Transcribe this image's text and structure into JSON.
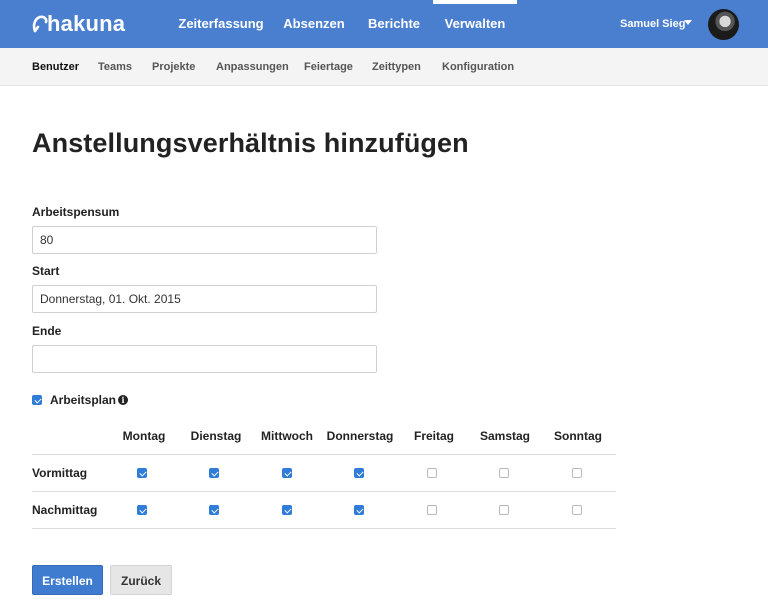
{
  "brand": {
    "name": "hakuna"
  },
  "topnav": {
    "items": [
      {
        "label": "Zeiterfassung",
        "active": false
      },
      {
        "label": "Absenzen",
        "active": false
      },
      {
        "label": "Berichte",
        "active": false
      },
      {
        "label": "Verwalten",
        "active": true
      }
    ],
    "user": {
      "name": "Samuel Sieg",
      "avatar_icon": "user-avatar"
    }
  },
  "subnav": {
    "items": [
      {
        "label": "Benutzer",
        "active": true
      },
      {
        "label": "Teams",
        "active": false
      },
      {
        "label": "Projekte",
        "active": false
      },
      {
        "label": "Anpassungen",
        "active": false
      },
      {
        "label": "Feiertage",
        "active": false
      },
      {
        "label": "Zeittypen",
        "active": false
      },
      {
        "label": "Konfiguration",
        "active": false
      }
    ]
  },
  "form": {
    "title": "Anstellungsverhältnis hinzufügen",
    "fields": {
      "pensum": {
        "label": "Arbeitspensum",
        "value": "80"
      },
      "start": {
        "label": "Start",
        "value": "Donnerstag, 01. Okt. 2015"
      },
      "ende": {
        "label": "Ende",
        "value": ""
      }
    },
    "arbeitsplan": {
      "label": "Arbeitsplan",
      "checked": true,
      "info_icon": "info-circle-icon"
    },
    "schedule": {
      "days": [
        "Montag",
        "Dienstag",
        "Mittwoch",
        "Donnerstag",
        "Freitag",
        "Samstag",
        "Sonntag"
      ],
      "rows": [
        {
          "label": "Vormittag",
          "values": [
            true,
            true,
            true,
            true,
            false,
            false,
            false
          ]
        },
        {
          "label": "Nachmittag",
          "values": [
            true,
            true,
            true,
            true,
            false,
            false,
            false
          ]
        }
      ]
    },
    "buttons": {
      "submit": "Erstellen",
      "back": "Zurück"
    }
  },
  "colors": {
    "topbar": "#4a7fd0",
    "primary_button": "#3f7cd0",
    "checkbox": "#2f7cd9"
  }
}
